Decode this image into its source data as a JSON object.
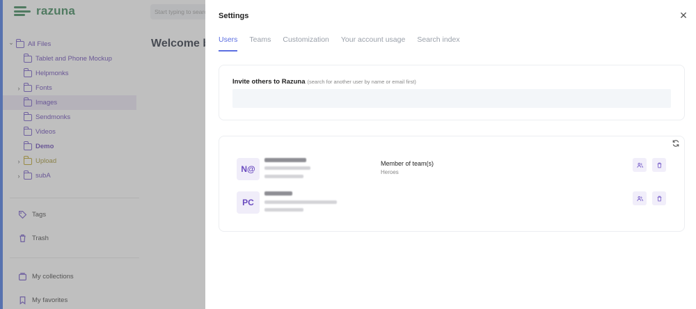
{
  "app": {
    "logo_text": "razuna",
    "brand_color": "#2e7d4f",
    "accent_color": "#5b6ee1",
    "search_placeholder": "Start typing to search",
    "welcome_text": "Welcome back"
  },
  "sidebar": {
    "tree": [
      {
        "label": "All Files",
        "chevron": "v",
        "indent": 0,
        "icon": "folder-icon"
      },
      {
        "label": "Tablet and Phone Mockup",
        "chevron": "",
        "indent": 1,
        "icon": "folder-icon"
      },
      {
        "label": "Helpmonks",
        "chevron": "",
        "indent": 1,
        "icon": "folder-icon"
      },
      {
        "label": "Fonts",
        "chevron": ">",
        "indent": 1,
        "icon": "folder-icon"
      },
      {
        "label": "Images",
        "chevron": "",
        "indent": 1,
        "icon": "folder-icon",
        "selected": true
      },
      {
        "label": "Sendmonks",
        "chevron": "",
        "indent": 1,
        "icon": "folder-icon"
      },
      {
        "label": "Videos",
        "chevron": "",
        "indent": 1,
        "icon": "folder-icon"
      },
      {
        "label": "Demo",
        "chevron": "",
        "indent": 1,
        "icon": "folder-icon",
        "bold": true
      },
      {
        "label": "Upload",
        "chevron": ">",
        "indent": 1,
        "icon": "folder-icon",
        "yellow": true
      },
      {
        "label": "subA",
        "chevron": ">",
        "indent": 1,
        "icon": "folder-icon"
      }
    ],
    "tags_label": "Tags",
    "trash_label": "Trash",
    "collections_label": "My collections",
    "favorites_label": "My favorites"
  },
  "settings": {
    "title": "Settings",
    "close_icon": "close-icon",
    "tabs": [
      {
        "label": "Users",
        "active": true
      },
      {
        "label": "Teams",
        "active": false
      },
      {
        "label": "Customization",
        "active": false
      },
      {
        "label": "Your account usage",
        "active": false
      },
      {
        "label": "Search index",
        "active": false
      }
    ],
    "invite": {
      "title": "Invite others to Razuna",
      "hint": "(search for another user by name or email first)",
      "input_value": "",
      "input_placeholder": ""
    },
    "users": [
      {
        "initials": "N@",
        "member_label": "Member of team(s)",
        "member_value": "Heroes"
      },
      {
        "initials": "PC",
        "member_label": "",
        "member_value": ""
      }
    ]
  }
}
